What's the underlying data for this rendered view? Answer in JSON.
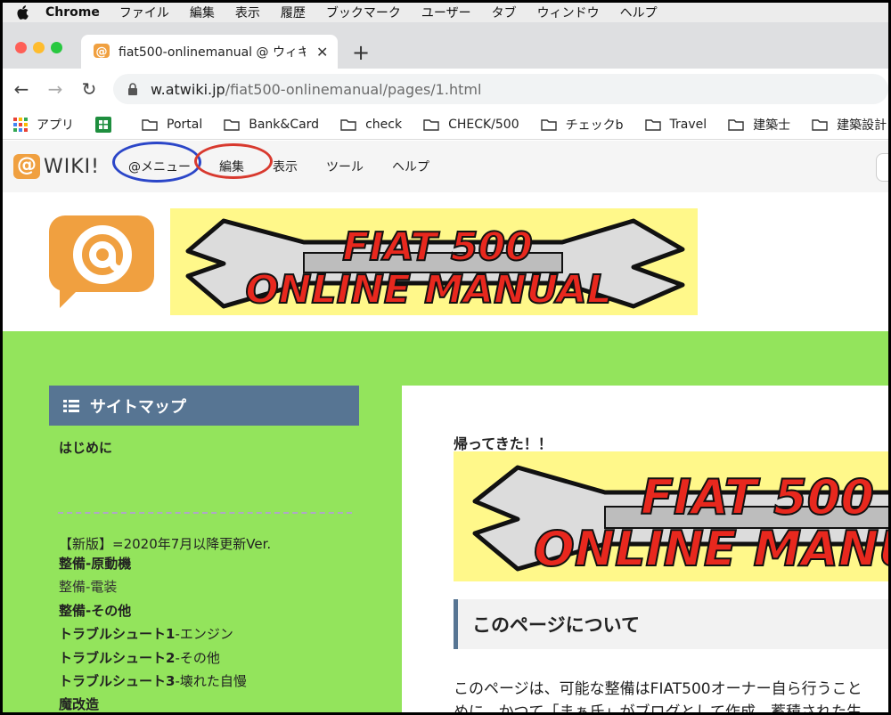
{
  "macmenu": {
    "app": "Chrome",
    "items": [
      "ファイル",
      "編集",
      "表示",
      "履歴",
      "ブックマーク",
      "ユーザー",
      "タブ",
      "ウィンドウ",
      "ヘルプ"
    ]
  },
  "tab": {
    "title": "fiat500-onlinemanual @ ウィキ"
  },
  "address": {
    "host": "w.atwiki.jp",
    "path": "/fiat500-onlinemanual/pages/1.html"
  },
  "bookmarks": [
    "アプリ",
    "",
    "Portal",
    "Bank&Card",
    "check",
    "CHECK/500",
    "チェックb",
    "Travel",
    "建築士",
    "建築設計"
  ],
  "wiki": {
    "logo_text": "WIKI!",
    "menu": [
      "@メニュー",
      "編集",
      "表示",
      "ツール",
      "ヘルプ"
    ]
  },
  "banner": {
    "line1": "FIAT 500",
    "line2": "ONLINE MANUAL"
  },
  "sidebar": {
    "title": "サイトマップ",
    "intro": "はじめに",
    "version": "【新版】=2020年7月以降更新Ver.",
    "items": [
      {
        "b": "整備-原動機",
        "n": ""
      },
      {
        "b": "",
        "n": "整備-電装"
      },
      {
        "b": "整備-その他",
        "n": ""
      },
      {
        "b": "トラブルシュート1",
        "n": "-エンジン"
      },
      {
        "b": "トラブルシュート2",
        "n": "-その他"
      },
      {
        "b": "トラブルシュート3",
        "n": "-壊れた自慢"
      },
      {
        "b": "魔改造",
        "n": ""
      }
    ]
  },
  "content": {
    "back": "帰ってきた！！",
    "section": "このページについて",
    "para1": "このページは、可能な整備はFIAT500オーナー自ら行うこと",
    "para2": "めに、かつて「まぁ氏」がブログとして作成、蓄積された生"
  },
  "colors": {
    "green": "#93e45c",
    "sidebar_head": "#577593",
    "banner_yellow": "#fff88a",
    "banner_red": "#e8281e"
  }
}
